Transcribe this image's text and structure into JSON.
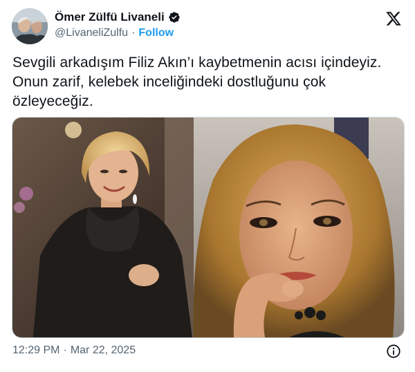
{
  "author": {
    "display_name": "Ömer Zülfü Livaneli",
    "handle": "@LivaneliZulfu",
    "separator": "·",
    "follow_label": "Follow",
    "verified": true
  },
  "tweet": {
    "lines": [
      "Sevgili arkadışım Filiz Akın’ı kaybetmenin acısı içindeyiz.",
      "Onun zarif, kelebek inceliğindeki dostluğunu çok",
      "özleyeceğiz."
    ]
  },
  "media": {
    "images": [
      "photo-left",
      "photo-right"
    ]
  },
  "footer": {
    "time": "12:29 PM",
    "separator": "·",
    "date": "Mar 22, 2025"
  },
  "icons": {
    "verified": "verified-badge-icon",
    "brand": "x-logo-icon",
    "info": "info-icon"
  },
  "colors": {
    "text": "#0f1419",
    "secondary": "#536471",
    "link": "#1d9bf0"
  }
}
